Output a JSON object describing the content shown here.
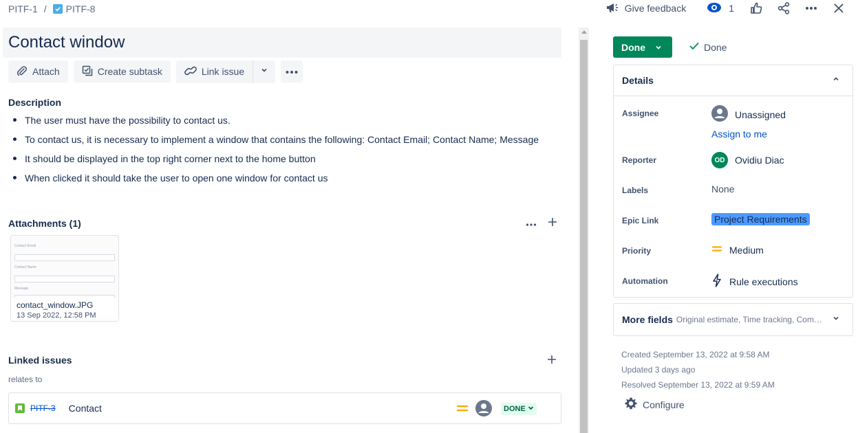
{
  "breadcrumb": {
    "parent_key": "PITF-1",
    "separator": "/",
    "issue_key": "PITF-8"
  },
  "header": {
    "feedback_label": "Give feedback",
    "watchers_count": "1"
  },
  "issue": {
    "title": "Contact window",
    "toolbar": {
      "attach": "Attach",
      "create_subtask": "Create subtask",
      "link_issue": "Link issue"
    },
    "description": {
      "heading": "Description",
      "items": [
        "The user must have the possibility to contact us.",
        "To contact us, it is necessary to implement a window that contains the following: Contact Email; Contact Name; Message",
        "It should be displayed in the top right corner next to the home button",
        "When clicked it should take the user to open one window for contact us"
      ]
    },
    "attachments": {
      "heading": "Attachments (1)",
      "files": [
        {
          "name": "contact_window.JPG",
          "date": "13 Sep 2022, 12:58 PM"
        }
      ],
      "thumb_labels": [
        "Contact Email",
        "Contact Name",
        "Message"
      ]
    },
    "linked_issues": {
      "heading": "Linked issues",
      "relation": "relates to",
      "items": [
        {
          "key": "PITF-3",
          "summary": "Contact",
          "status": "DONE"
        }
      ]
    }
  },
  "status": {
    "button_label": "Done",
    "resolution": "Done",
    "button_color": "#00875a"
  },
  "details": {
    "heading": "Details",
    "assignee": {
      "label": "Assignee",
      "value": "Unassigned",
      "assign_me": "Assign to me"
    },
    "reporter": {
      "label": "Reporter",
      "initials": "OD",
      "name": "Ovidiu Diac"
    },
    "labels": {
      "label": "Labels",
      "value": "None"
    },
    "epic_link": {
      "label": "Epic Link",
      "value": "Project Requirements",
      "color": "#4c9aff"
    },
    "priority": {
      "label": "Priority",
      "value": "Medium",
      "color": "#ffab00"
    },
    "automation": {
      "label": "Automation",
      "value": "Rule executions"
    }
  },
  "more_fields": {
    "label": "More fields",
    "sub": "Original estimate, Time tracking, Component/s, Fix versions, Sprint"
  },
  "meta": {
    "created": "Created September 13, 2022 at 9:58 AM",
    "updated": "Updated 3 days ago",
    "resolved": "Resolved September 13, 2022 at 9:59 AM",
    "configure": "Configure"
  },
  "icons": [
    "checkbox-icon",
    "megaphone-icon",
    "eye-icon",
    "thumbs-up-icon",
    "share-icon",
    "more-icon",
    "close-icon",
    "paperclip-icon",
    "subtask-icon",
    "link-icon",
    "chevron-down-icon",
    "plus-icon",
    "story-icon",
    "priority-medium-icon",
    "avatar-icon",
    "check-icon",
    "chevron-up-icon",
    "lightning-icon",
    "gear-icon"
  ]
}
